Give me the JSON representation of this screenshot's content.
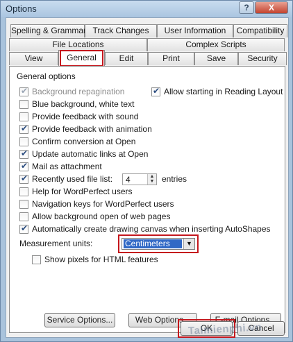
{
  "window": {
    "title": "Options",
    "help_label": "?",
    "close_label": "X"
  },
  "tabs_row1": [
    "Spelling & Grammar",
    "Track Changes",
    "User Information",
    "Compatibility"
  ],
  "tabs_row2": [
    "File Locations",
    "Complex Scripts"
  ],
  "tabs_row3": [
    "View",
    "General",
    "Edit",
    "Print",
    "Save",
    "Security"
  ],
  "active_tab": "General",
  "panel": {
    "group_title": "General options",
    "options": [
      {
        "label": "Background repagination",
        "checked": true,
        "disabled": true
      },
      {
        "label": "Allow starting in Reading Layout",
        "checked": true,
        "disabled": false
      },
      {
        "label": "Blue background, white text",
        "checked": false,
        "disabled": false
      },
      {
        "label": "Provide feedback with sound",
        "checked": false,
        "disabled": false
      },
      {
        "label": "Provide feedback with animation",
        "checked": true,
        "disabled": false
      },
      {
        "label": "Confirm conversion at Open",
        "checked": false,
        "disabled": false
      },
      {
        "label": "Update automatic links at Open",
        "checked": true,
        "disabled": false
      },
      {
        "label": "Mail as attachment",
        "checked": true,
        "disabled": false
      },
      {
        "label": "Recently used file list:",
        "checked": true,
        "disabled": false
      },
      {
        "label": "Help for WordPerfect users",
        "checked": false,
        "disabled": false
      },
      {
        "label": "Navigation keys for WordPerfect users",
        "checked": false,
        "disabled": false
      },
      {
        "label": "Allow background open of web pages",
        "checked": false,
        "disabled": false
      },
      {
        "label": "Automatically create drawing canvas when inserting AutoShapes",
        "checked": true,
        "disabled": false
      },
      {
        "label": "Show pixels for HTML features",
        "checked": false,
        "disabled": false
      }
    ],
    "recent_files_count": "4",
    "recent_files_suffix": "entries",
    "measurement_label": "Measurement units:",
    "measurement_value": "Centimeters",
    "buttons": {
      "service": "Service Options...",
      "web": "Web Options...",
      "email": "E-mail Options..."
    }
  },
  "footer": {
    "ok": "OK",
    "cancel": "Cancel"
  },
  "watermark": "Taimienphi.vn",
  "colors": {
    "highlight": "#c4161c",
    "selection": "#3169c6"
  }
}
